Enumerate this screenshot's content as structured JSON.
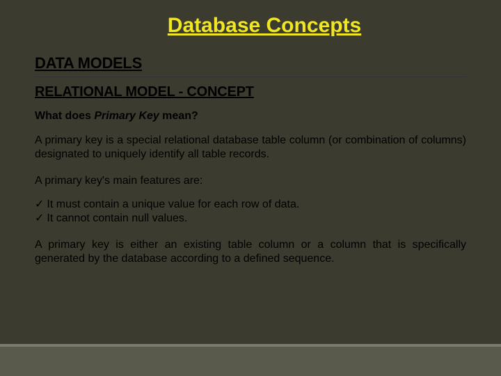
{
  "title": "Database Concepts",
  "heading1": "DATA MODELS",
  "heading2": "RELATIONAL MODEL - CONCEPT",
  "question_prefix": "What does ",
  "question_term": "Primary Key",
  "question_suffix": " mean?",
  "para1": "A primary key is a special relational database table column (or combination of columns) designated to uniquely identify all table records.",
  "para2": "A primary key's main features are:",
  "bullet1": "It must contain a unique value for each row of data.",
  "bullet2": "It cannot contain null values.",
  "para3": "A primary key is either an existing table column or a column that is specifically generated by the database according to a defined sequence."
}
